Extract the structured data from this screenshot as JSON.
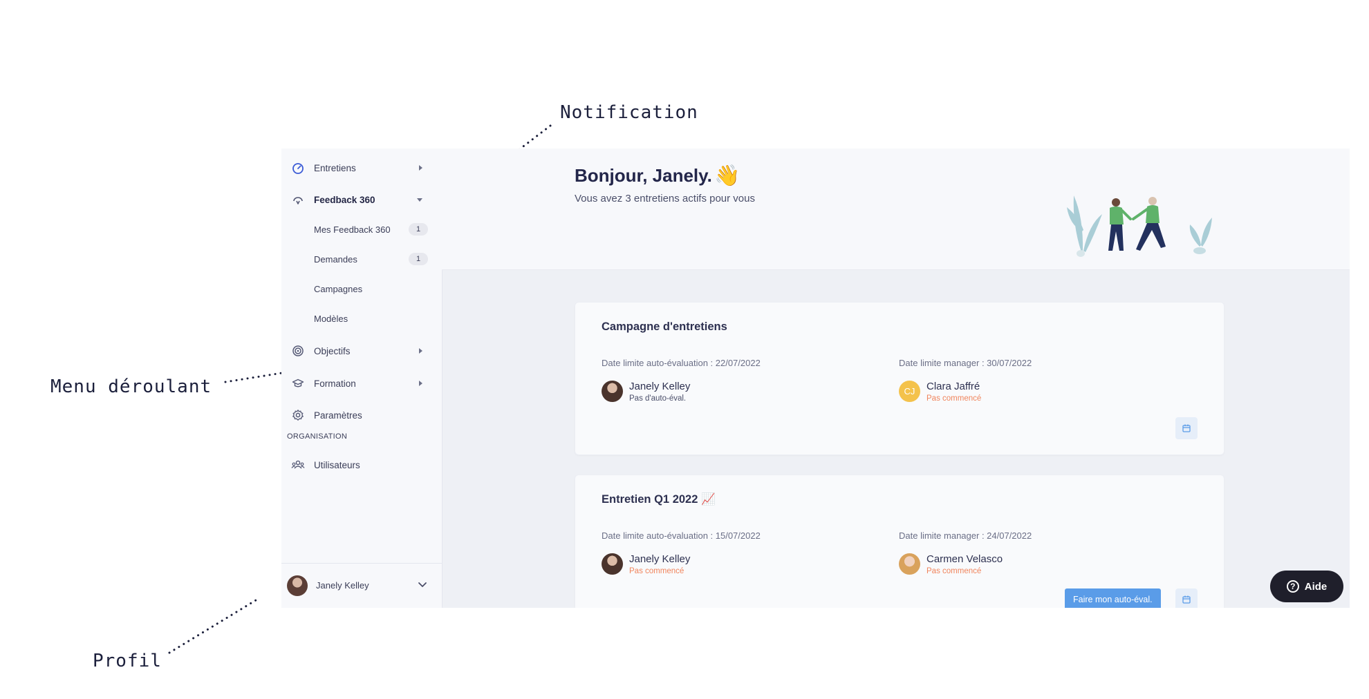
{
  "annotations": {
    "notification": "Notification",
    "menu": "Menu déroulant",
    "profile": "Profil"
  },
  "sidebar": {
    "items": [
      {
        "label": "Entretiens",
        "icon": "gauge-icon"
      },
      {
        "label": "Feedback 360",
        "icon": "feedback-icon"
      },
      {
        "label": "Objectifs",
        "icon": "target-icon"
      },
      {
        "label": "Formation",
        "icon": "graduation-cap-icon"
      },
      {
        "label": "Paramètres",
        "icon": "gear-icon"
      },
      {
        "label": "Utilisateurs",
        "icon": "users-icon"
      }
    ],
    "feedback_sub": [
      {
        "label": "Mes Feedback 360",
        "badge": "1"
      },
      {
        "label": "Demandes",
        "badge": "1"
      },
      {
        "label": "Campagnes"
      },
      {
        "label": "Modèles"
      }
    ],
    "section_label": "ORGANISATION",
    "profile_name": "Janely Kelley"
  },
  "hero": {
    "title": "Bonjour, Janely.",
    "wave": "👋",
    "subtitle": "Vous avez 3 entretiens actifs pour vous"
  },
  "cards": [
    {
      "title": "Campagne d'entretiens",
      "self_deadline": "Date limite auto-évaluation : 22/07/2022",
      "manager_deadline": "Date limite manager : 30/07/2022",
      "employee": {
        "name": "Janely Kelley",
        "status": "Pas d'auto-éval."
      },
      "manager": {
        "name": "Clara Jaffré",
        "initials": "CJ",
        "status": "Pas commencé"
      }
    },
    {
      "title": "Entretien Q1 2022 📈",
      "self_deadline": "Date limite auto-évaluation : 15/07/2022",
      "manager_deadline": "Date limite manager : 24/07/2022",
      "employee": {
        "name": "Janely Kelley",
        "status": "Pas commencé"
      },
      "manager": {
        "name": "Carmen Velasco",
        "status": "Pas commencé"
      },
      "action_label": "Faire mon auto-éval."
    }
  ],
  "help": {
    "label": "Aide"
  },
  "colors": {
    "accent": "#5a9ce8",
    "warning": "#f0845c",
    "muted": "#6a6e86",
    "manager_avatar": "#f4c24b"
  }
}
